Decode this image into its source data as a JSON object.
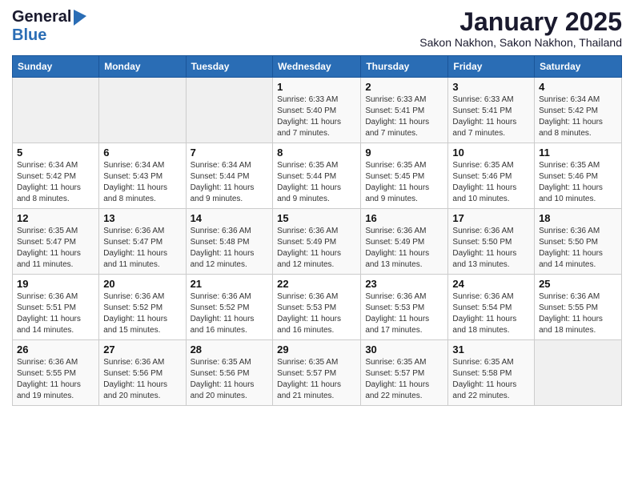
{
  "header": {
    "logo_general": "General",
    "logo_blue": "Blue",
    "month_title": "January 2025",
    "subtitle": "Sakon Nakhon, Sakon Nakhon, Thailand"
  },
  "weekdays": [
    "Sunday",
    "Monday",
    "Tuesday",
    "Wednesday",
    "Thursday",
    "Friday",
    "Saturday"
  ],
  "weeks": [
    [
      {
        "day": "",
        "sunrise": "",
        "sunset": "",
        "daylight": ""
      },
      {
        "day": "",
        "sunrise": "",
        "sunset": "",
        "daylight": ""
      },
      {
        "day": "",
        "sunrise": "",
        "sunset": "",
        "daylight": ""
      },
      {
        "day": "1",
        "sunrise": "Sunrise: 6:33 AM",
        "sunset": "Sunset: 5:40 PM",
        "daylight": "Daylight: 11 hours and 7 minutes."
      },
      {
        "day": "2",
        "sunrise": "Sunrise: 6:33 AM",
        "sunset": "Sunset: 5:41 PM",
        "daylight": "Daylight: 11 hours and 7 minutes."
      },
      {
        "day": "3",
        "sunrise": "Sunrise: 6:33 AM",
        "sunset": "Sunset: 5:41 PM",
        "daylight": "Daylight: 11 hours and 7 minutes."
      },
      {
        "day": "4",
        "sunrise": "Sunrise: 6:34 AM",
        "sunset": "Sunset: 5:42 PM",
        "daylight": "Daylight: 11 hours and 8 minutes."
      }
    ],
    [
      {
        "day": "5",
        "sunrise": "Sunrise: 6:34 AM",
        "sunset": "Sunset: 5:42 PM",
        "daylight": "Daylight: 11 hours and 8 minutes."
      },
      {
        "day": "6",
        "sunrise": "Sunrise: 6:34 AM",
        "sunset": "Sunset: 5:43 PM",
        "daylight": "Daylight: 11 hours and 8 minutes."
      },
      {
        "day": "7",
        "sunrise": "Sunrise: 6:34 AM",
        "sunset": "Sunset: 5:44 PM",
        "daylight": "Daylight: 11 hours and 9 minutes."
      },
      {
        "day": "8",
        "sunrise": "Sunrise: 6:35 AM",
        "sunset": "Sunset: 5:44 PM",
        "daylight": "Daylight: 11 hours and 9 minutes."
      },
      {
        "day": "9",
        "sunrise": "Sunrise: 6:35 AM",
        "sunset": "Sunset: 5:45 PM",
        "daylight": "Daylight: 11 hours and 9 minutes."
      },
      {
        "day": "10",
        "sunrise": "Sunrise: 6:35 AM",
        "sunset": "Sunset: 5:46 PM",
        "daylight": "Daylight: 11 hours and 10 minutes."
      },
      {
        "day": "11",
        "sunrise": "Sunrise: 6:35 AM",
        "sunset": "Sunset: 5:46 PM",
        "daylight": "Daylight: 11 hours and 10 minutes."
      }
    ],
    [
      {
        "day": "12",
        "sunrise": "Sunrise: 6:35 AM",
        "sunset": "Sunset: 5:47 PM",
        "daylight": "Daylight: 11 hours and 11 minutes."
      },
      {
        "day": "13",
        "sunrise": "Sunrise: 6:36 AM",
        "sunset": "Sunset: 5:47 PM",
        "daylight": "Daylight: 11 hours and 11 minutes."
      },
      {
        "day": "14",
        "sunrise": "Sunrise: 6:36 AM",
        "sunset": "Sunset: 5:48 PM",
        "daylight": "Daylight: 11 hours and 12 minutes."
      },
      {
        "day": "15",
        "sunrise": "Sunrise: 6:36 AM",
        "sunset": "Sunset: 5:49 PM",
        "daylight": "Daylight: 11 hours and 12 minutes."
      },
      {
        "day": "16",
        "sunrise": "Sunrise: 6:36 AM",
        "sunset": "Sunset: 5:49 PM",
        "daylight": "Daylight: 11 hours and 13 minutes."
      },
      {
        "day": "17",
        "sunrise": "Sunrise: 6:36 AM",
        "sunset": "Sunset: 5:50 PM",
        "daylight": "Daylight: 11 hours and 13 minutes."
      },
      {
        "day": "18",
        "sunrise": "Sunrise: 6:36 AM",
        "sunset": "Sunset: 5:50 PM",
        "daylight": "Daylight: 11 hours and 14 minutes."
      }
    ],
    [
      {
        "day": "19",
        "sunrise": "Sunrise: 6:36 AM",
        "sunset": "Sunset: 5:51 PM",
        "daylight": "Daylight: 11 hours and 14 minutes."
      },
      {
        "day": "20",
        "sunrise": "Sunrise: 6:36 AM",
        "sunset": "Sunset: 5:52 PM",
        "daylight": "Daylight: 11 hours and 15 minutes."
      },
      {
        "day": "21",
        "sunrise": "Sunrise: 6:36 AM",
        "sunset": "Sunset: 5:52 PM",
        "daylight": "Daylight: 11 hours and 16 minutes."
      },
      {
        "day": "22",
        "sunrise": "Sunrise: 6:36 AM",
        "sunset": "Sunset: 5:53 PM",
        "daylight": "Daylight: 11 hours and 16 minutes."
      },
      {
        "day": "23",
        "sunrise": "Sunrise: 6:36 AM",
        "sunset": "Sunset: 5:53 PM",
        "daylight": "Daylight: 11 hours and 17 minutes."
      },
      {
        "day": "24",
        "sunrise": "Sunrise: 6:36 AM",
        "sunset": "Sunset: 5:54 PM",
        "daylight": "Daylight: 11 hours and 18 minutes."
      },
      {
        "day": "25",
        "sunrise": "Sunrise: 6:36 AM",
        "sunset": "Sunset: 5:55 PM",
        "daylight": "Daylight: 11 hours and 18 minutes."
      }
    ],
    [
      {
        "day": "26",
        "sunrise": "Sunrise: 6:36 AM",
        "sunset": "Sunset: 5:55 PM",
        "daylight": "Daylight: 11 hours and 19 minutes."
      },
      {
        "day": "27",
        "sunrise": "Sunrise: 6:36 AM",
        "sunset": "Sunset: 5:56 PM",
        "daylight": "Daylight: 11 hours and 20 minutes."
      },
      {
        "day": "28",
        "sunrise": "Sunrise: 6:35 AM",
        "sunset": "Sunset: 5:56 PM",
        "daylight": "Daylight: 11 hours and 20 minutes."
      },
      {
        "day": "29",
        "sunrise": "Sunrise: 6:35 AM",
        "sunset": "Sunset: 5:57 PM",
        "daylight": "Daylight: 11 hours and 21 minutes."
      },
      {
        "day": "30",
        "sunrise": "Sunrise: 6:35 AM",
        "sunset": "Sunset: 5:57 PM",
        "daylight": "Daylight: 11 hours and 22 minutes."
      },
      {
        "day": "31",
        "sunrise": "Sunrise: 6:35 AM",
        "sunset": "Sunset: 5:58 PM",
        "daylight": "Daylight: 11 hours and 22 minutes."
      },
      {
        "day": "",
        "sunrise": "",
        "sunset": "",
        "daylight": ""
      }
    ]
  ]
}
